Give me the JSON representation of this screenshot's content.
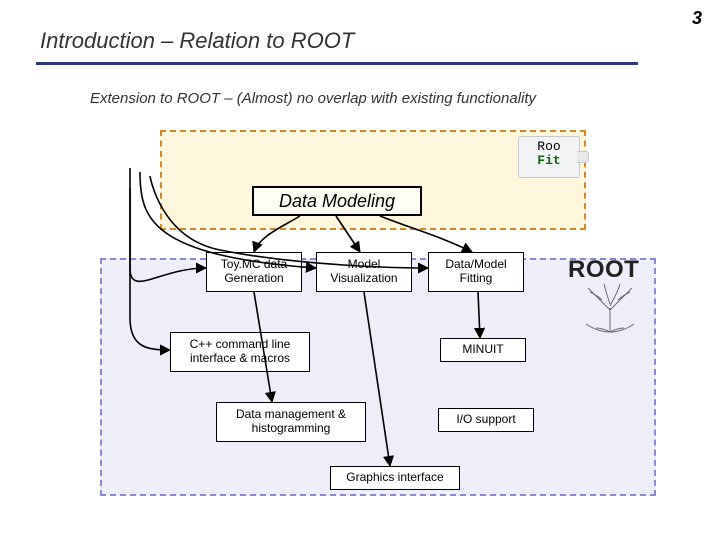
{
  "page_number": "3",
  "title": "Introduction – Relation to ROOT",
  "subtitle": "Extension to ROOT – (Almost) no overlap with existing functionality",
  "roofit": {
    "line1": "Roo",
    "line2": "Fit"
  },
  "heading": "Data Modeling",
  "boxes": {
    "toymc": {
      "l1": "Toy.MC data",
      "l2": "Generation"
    },
    "modelvis": {
      "l1": "Model",
      "l2": "Visualization"
    },
    "fitting": {
      "l1": "Data/Model",
      "l2": "Fitting"
    },
    "cli": {
      "l1": "C++ command line",
      "l2": "interface & macros"
    },
    "datamgmt": {
      "l1": "Data management &",
      "l2": "histogramming"
    },
    "minuit": "MINUIT",
    "iosupport": "I/O support",
    "gfx": "Graphics interface"
  },
  "root_logo": "ROOT"
}
